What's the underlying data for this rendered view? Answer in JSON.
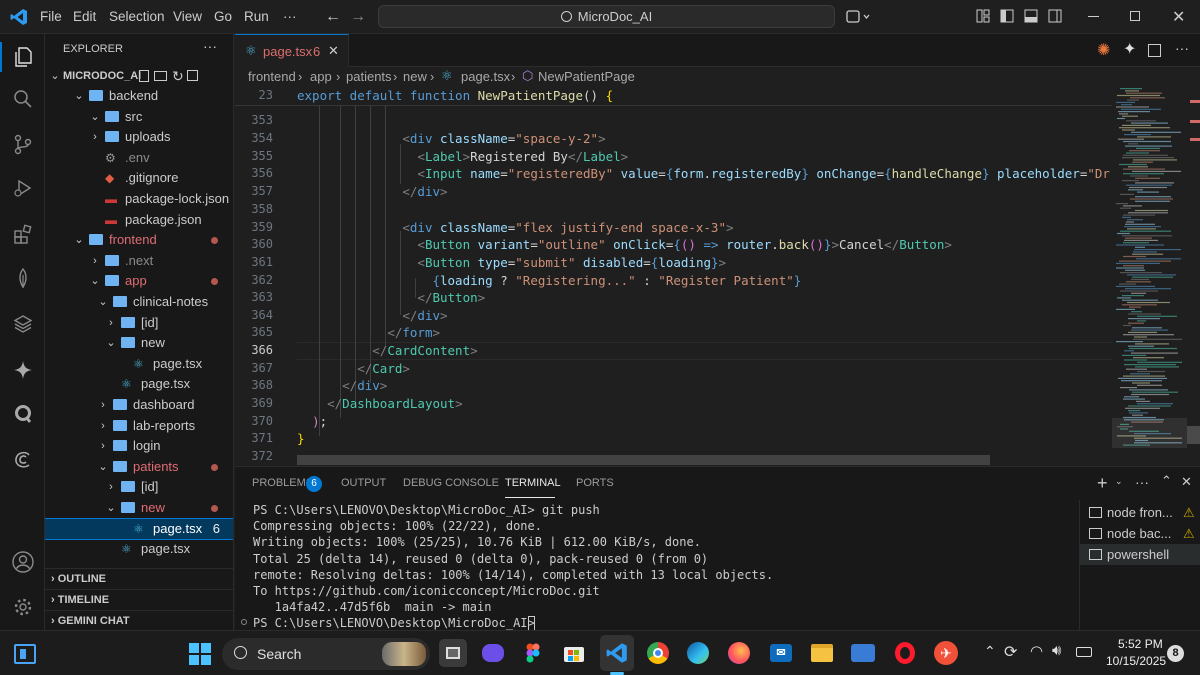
{
  "titlebar": {
    "menus": [
      "File",
      "Edit",
      "Selection",
      "View",
      "Go",
      "Run",
      "···"
    ],
    "command_center": "MicroDoc_AI"
  },
  "explorer": {
    "title": "EXPLORER",
    "root": "MICRODOC_AI",
    "items": [
      {
        "label": "backend",
        "type": "folder",
        "depth": 1,
        "open": true
      },
      {
        "label": "src",
        "type": "folder",
        "depth": 2,
        "open": true
      },
      {
        "label": "uploads",
        "type": "folder",
        "depth": 2,
        "open": false
      },
      {
        "label": ".env",
        "type": "env",
        "depth": 2
      },
      {
        "label": ".gitignore",
        "type": "git",
        "depth": 2
      },
      {
        "label": "package-lock.json",
        "type": "npm",
        "depth": 2
      },
      {
        "label": "package.json",
        "type": "npm",
        "depth": 2
      },
      {
        "label": "frontend",
        "type": "folder",
        "depth": 1,
        "open": true,
        "modified": true
      },
      {
        "label": ".next",
        "type": "folder",
        "depth": 2,
        "open": false
      },
      {
        "label": "app",
        "type": "folder",
        "depth": 2,
        "open": true,
        "modified": true
      },
      {
        "label": "clinical-notes",
        "type": "folder",
        "depth": 3,
        "open": true
      },
      {
        "label": "[id]",
        "type": "folder",
        "depth": 4,
        "open": false
      },
      {
        "label": "new",
        "type": "folder",
        "depth": 4,
        "open": true
      },
      {
        "label": "page.tsx",
        "type": "react",
        "depth": 5
      },
      {
        "label": "page.tsx",
        "type": "react",
        "depth": 4
      },
      {
        "label": "dashboard",
        "type": "folder",
        "depth": 3,
        "open": false
      },
      {
        "label": "lab-reports",
        "type": "folder",
        "depth": 3,
        "open": false
      },
      {
        "label": "login",
        "type": "folder",
        "depth": 3,
        "open": false
      },
      {
        "label": "patients",
        "type": "folder",
        "depth": 3,
        "open": true,
        "modified": true
      },
      {
        "label": "[id]",
        "type": "folder",
        "depth": 4,
        "open": false
      },
      {
        "label": "new",
        "type": "folder",
        "depth": 4,
        "open": true,
        "modified": true
      },
      {
        "label": "page.tsx",
        "type": "react",
        "depth": 5,
        "selected": true,
        "badge": "6"
      },
      {
        "label": "page.tsx",
        "type": "react",
        "depth": 4
      }
    ],
    "sections": [
      "OUTLINE",
      "TIMELINE",
      "GEMINI CHAT"
    ]
  },
  "tab": {
    "label": "page.tsx",
    "badge": "6"
  },
  "breadcrumb": [
    "frontend",
    "app",
    "patients",
    "new",
    "page.tsx",
    "NewPatientPage"
  ],
  "editor": {
    "sticky_line": "23",
    "line_numbers": [
      "353",
      "354",
      "355",
      "356",
      "357",
      "358",
      "359",
      "360",
      "361",
      "362",
      "363",
      "364",
      "365",
      "366",
      "367",
      "368",
      "369",
      "370",
      "371",
      "372"
    ],
    "current_line": "366"
  },
  "panel": {
    "tabs": [
      "PROBLEMS",
      "OUTPUT",
      "DEBUG CONSOLE",
      "TERMINAL",
      "PORTS"
    ],
    "problems_count": "6",
    "active_tab": "TERMINAL",
    "terminal_lines": [
      "PS C:\\Users\\LENOVO\\Desktop\\MicroDoc_AI> git push",
      "Compressing objects: 100% (22/22), done.",
      "Writing objects: 100% (25/25), 10.76 KiB | 612.00 KiB/s, done.",
      "Total 25 (delta 14), reused 0 (delta 0), pack-reused 0 (from 0)",
      "remote: Resolving deltas: 100% (14/14), completed with 13 local objects.",
      "To https://github.com/iconicconcept/MicroDoc.git",
      "   1a4fa42..47d5f6b  main -> main",
      "PS C:\\Users\\LENOVO\\Desktop\\MicroDoc_AI> "
    ],
    "terminals": [
      {
        "label": "node fron...",
        "warn": true
      },
      {
        "label": "node bac...",
        "warn": true
      },
      {
        "label": "powershell",
        "warn": false,
        "active": true
      }
    ]
  },
  "taskbar": {
    "search": "Search",
    "time": "5:52 PM",
    "date": "10/15/2025",
    "notifications": "8"
  },
  "colors": {
    "accent": "#0078d4",
    "folder": "#6fb3f3",
    "modified": "#b4574f",
    "warning": "#cca700"
  }
}
